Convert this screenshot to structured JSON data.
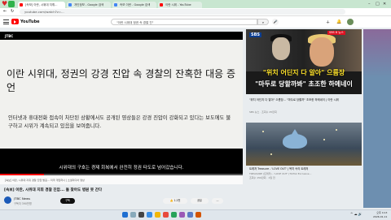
{
  "browser": {
    "tabs": [
      {
        "label": "[속보] 이란, 시위대 지휘...",
        "color": "#ff0000",
        "active": true
      },
      {
        "label": "개인정보 - Google 검색",
        "color": "#4285f4",
        "active": false
      },
      {
        "label": "속보 이란 - Google 검색",
        "color": "#4285f4",
        "active": false
      },
      {
        "label": "이란 시위 - YouTube",
        "color": "#ff0000",
        "active": false
      }
    ],
    "url": "youtube.com/watch?v=..."
  },
  "youtube": {
    "logo_text": "YouTube",
    "search_value": "\"이란 시위대 정권 속 경찰 진\""
  },
  "video": {
    "channel_logo": "JTBC",
    "slide_title": "이란 시위대, 정권의 강경 진압 속 경찰의 잔혹한 대응 증언",
    "slide_body": "인터넷과 휴대전화 접속이 차단된 상황에서도 공개된 영상들은 강경 진압이 강화되고 있다는 보도에도 불구하고 시위가 계속되고 있음을 보여줍니다.",
    "subtitle": "시위대의 구호는 경제 회복에서 완전히 정권 타도로 넘어갔습니다.",
    "progress_percent": 18,
    "info_text": "[속보] 이란, 시위대 지휘 경찰 진압 발표... 미국 개입하나 | 소셜미디어 영상",
    "title": "[속보] 이란, 시위대 지휘 경찰 진압... 돌 찾아도 병원 못 간다",
    "channel_name": "JTBC News",
    "channel_subs": "구독자 390만명",
    "subscribe_label": "구독",
    "like_label": "👍 1.2천",
    "share_label": "공유",
    "more_label": "..."
  },
  "sidebar": {
    "thumb1": {
      "badge": "SBS",
      "tag": "SBS 8 뉴스",
      "line1": "\"위치 어딘지 다 알아\" 으름장",
      "line2": "\"마두로 당할까봐\" 초조한 하메네이",
      "title": "\"위치 어딘지 다 알아\" 으름장... \"마두로 당할까\" 초조한 하메네이 | 이란 시위",
      "meta": "SBS 뉴스 · 조회수 25만회"
    },
    "thumb2": {
      "title": "트레저 Treasure - 'LOVE OUT' | 복지 속의 트레저",
      "meta": "TREASURE (트레저) - 'LOVE OUT' (TikTok Exclusive...",
      "meta2": "조회수 150만회 · 1일 전"
    }
  },
  "taskbar": {
    "time": "오후 4:13",
    "date": "2026-01-11"
  }
}
